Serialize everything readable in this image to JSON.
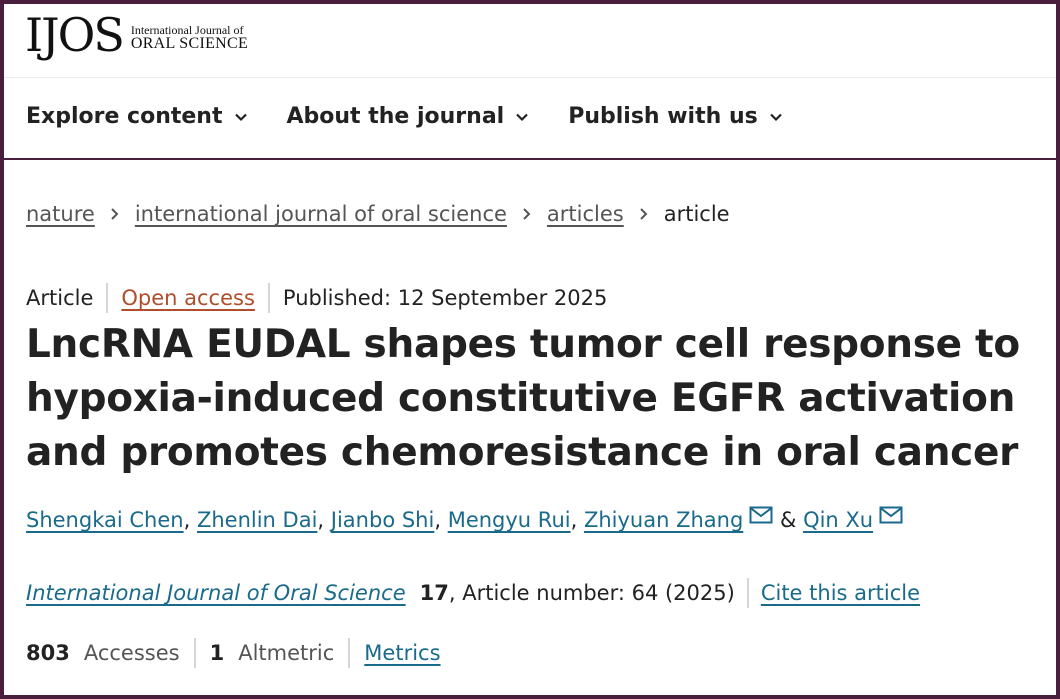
{
  "logo": {
    "abbrev": "IJOS",
    "line1": "International Journal of",
    "line2": "ORAL SCIENCE"
  },
  "nav": {
    "items": [
      {
        "label": "Explore content"
      },
      {
        "label": "About the journal"
      },
      {
        "label": "Publish with us"
      }
    ]
  },
  "breadcrumb": {
    "items": [
      "nature",
      "international journal of oral science",
      "articles"
    ],
    "current": "article"
  },
  "meta": {
    "type": "Article",
    "access": "Open access",
    "published": "Published: 12 September 2025"
  },
  "article": {
    "title": "LncRNA EUDAL shapes tumor cell response to hypoxia-induced constitutive EGFR activation and promotes chemoresistance in oral cancer"
  },
  "authors": {
    "list": [
      "Shengkai Chen",
      "Zhenlin Dai",
      "Jianbo Shi",
      "Mengyu Rui",
      "Zhiyuan Zhang",
      "Qin Xu"
    ],
    "separator": ",",
    "amp": "&"
  },
  "citation": {
    "journal": "International Journal of Oral Science",
    "volume": "17",
    "rest": ", Article number: 64 (2025)",
    "cite_label": "Cite this article"
  },
  "metrics": {
    "accesses_count": "803",
    "accesses_label": "Accesses",
    "altmetric_count": "1",
    "altmetric_label": "Altmetric",
    "metrics_label": "Metrics"
  },
  "colors": {
    "frame": "#4a1f3d",
    "link": "#1a6a8c",
    "open_access": "#b04d2a"
  },
  "icons": {
    "nav_chevron": "chevron-down-icon",
    "breadcrumb_sep": "chevron-right-icon",
    "author_mail": "envelope-icon"
  }
}
